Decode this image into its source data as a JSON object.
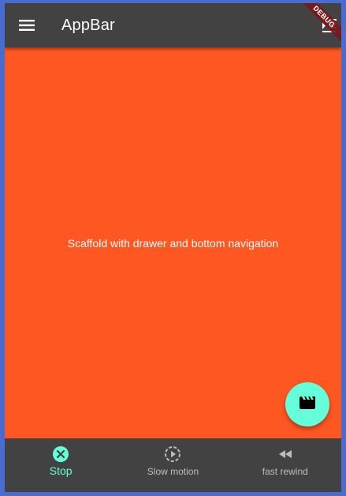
{
  "appbar": {
    "title": "AppBar",
    "menu_icon": "menu-icon",
    "action_icon": "format-indent-icon",
    "background": "#424242"
  },
  "debug_banner": {
    "label": "DEBUG",
    "color": "#7a1a1a"
  },
  "body": {
    "text": "Scaffold with drawer and bottom navigation",
    "background": "#ff5722"
  },
  "fab": {
    "icon": "movie-clapperboard-icon",
    "color": "#64ffda"
  },
  "bottom_nav": {
    "items": [
      {
        "label": "Stop",
        "icon": "cancel-icon",
        "active": true
      },
      {
        "label": "Slow motion",
        "icon": "slow-motion-video-icon",
        "active": false
      },
      {
        "label": "fast rewind",
        "icon": "fast-rewind-icon",
        "active": false
      }
    ],
    "active_color": "#64ffda",
    "inactive_color": "#bdbdbd",
    "background": "#424242"
  },
  "frame_border_color": "#4a6bd0"
}
